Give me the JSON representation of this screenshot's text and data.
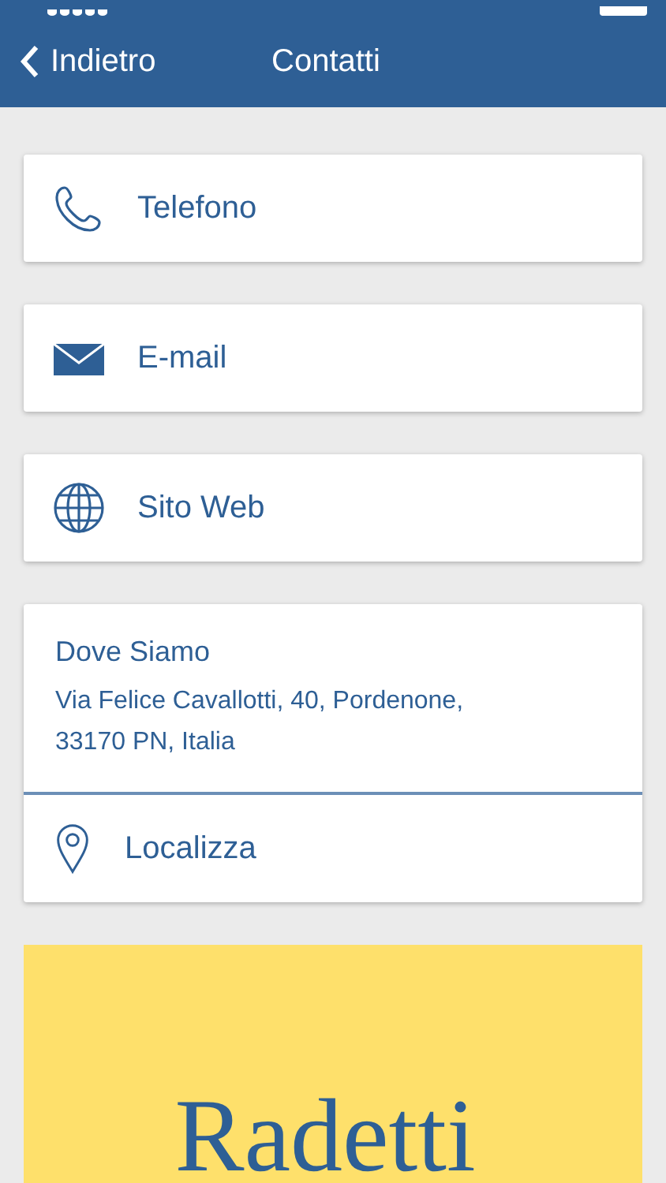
{
  "nav_bar": {
    "back": "Indietro",
    "title": "Contatti"
  },
  "contacts": [
    {
      "kind": "phone",
      "label": "Telefono"
    },
    {
      "kind": "email",
      "label": "E-mail"
    },
    {
      "kind": "web",
      "label": "Sito Web"
    }
  ],
  "location": {
    "heading": "Dove Siamo",
    "address": "Via Felice Cavallotti, 40, Pordenone, 33170 PN, Italia",
    "action": "Localizza"
  },
  "banner": {
    "logo": "Radetti"
  }
}
